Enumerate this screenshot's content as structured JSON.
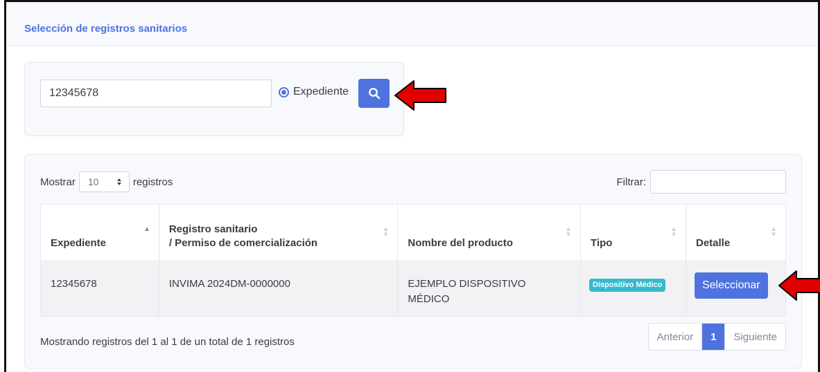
{
  "header": {
    "title": "Selección de registros sanitarios"
  },
  "search": {
    "value": "12345678",
    "radio_label": "Expediente",
    "radio_checked": true
  },
  "table_controls": {
    "show_prefix": "Mostrar",
    "page_length": "10",
    "show_suffix": "registros",
    "filter_label": "Filtrar:",
    "filter_value": ""
  },
  "table": {
    "columns": [
      {
        "line1": "",
        "line2": "Expediente"
      },
      {
        "line1": "Registro sanitario",
        "line2": "/ Permiso de comercialización"
      },
      {
        "line1": "",
        "line2": "Nombre del producto"
      },
      {
        "line1": "",
        "line2": "Tipo"
      },
      {
        "line1": "",
        "line2": "Detalle"
      }
    ],
    "rows": [
      {
        "expediente": "12345678",
        "registro": "INVIMA 2024DM-0000000",
        "producto_line1": "EJEMPLO DISPOSITIVO",
        "producto_line2": "MÉDICO",
        "tipo": "Dispositivo Médico",
        "detalle_button": "Seleccionar"
      }
    ]
  },
  "footer": {
    "info": "Mostrando registros del 1 al 1 de un total de 1 registros",
    "prev": "Anterior",
    "page": "1",
    "next": "Siguiente"
  },
  "colors": {
    "primary": "#4e73df",
    "badge": "#36b9cc",
    "arrow": "#e00000"
  },
  "icons": [
    "search-icon",
    "sort-icon",
    "select-caret-icon",
    "arrow-pointer-icon"
  ]
}
